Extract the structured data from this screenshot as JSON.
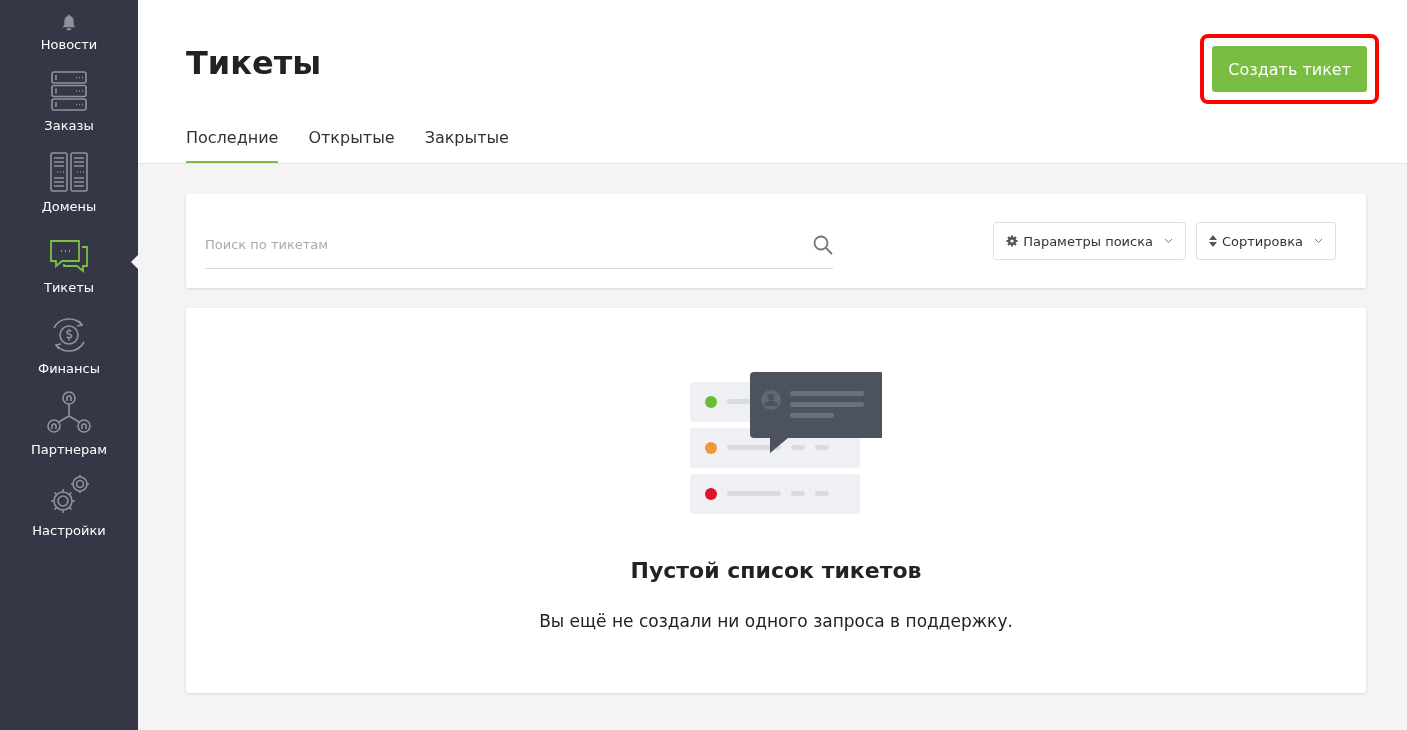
{
  "sidebar": {
    "items": [
      {
        "label": "Новости",
        "selected": false
      },
      {
        "label": "Заказы",
        "selected": false
      },
      {
        "label": "Домены",
        "selected": false
      },
      {
        "label": "Тикеты",
        "selected": true
      },
      {
        "label": "Финансы",
        "selected": false
      },
      {
        "label": "Партнерам",
        "selected": false
      },
      {
        "label": "Настройки",
        "selected": false
      }
    ]
  },
  "header": {
    "title": "Тикеты",
    "create_button": {
      "label": "Создать тикет",
      "highlighted": true
    }
  },
  "tabs": [
    {
      "label": "Последние",
      "selected": true
    },
    {
      "label": "Открытые",
      "selected": false
    },
    {
      "label": "Закрытые",
      "selected": false
    }
  ],
  "search": {
    "placeholder": "Поиск по тикетам",
    "params_button": "Параметры поиска",
    "sort_button": "Сортировка"
  },
  "empty_state": {
    "title": "Пустой список тикетов",
    "message": "Вы ещё не создали ни одного запроса в поддержку."
  }
}
